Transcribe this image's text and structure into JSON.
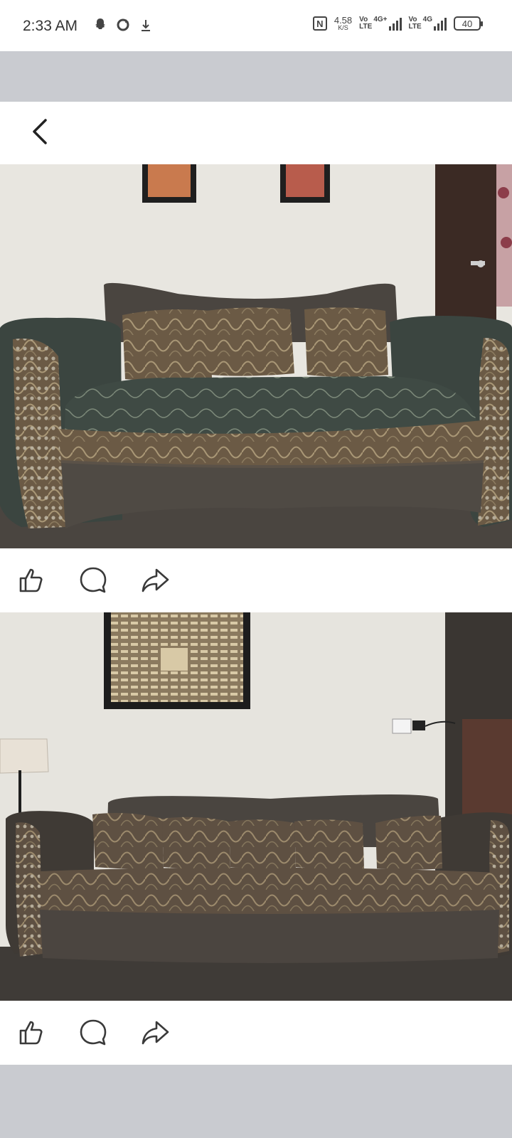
{
  "status_bar": {
    "time": "2:33 AM",
    "net_speed_value": "4.58",
    "net_speed_unit": "K/S",
    "sim1_label_top": "Vo",
    "sim1_label_bottom": "LTE",
    "sim1_network": "4G+",
    "sim2_label_top": "Vo",
    "sim2_label_bottom": "LTE",
    "sim2_network": "4G",
    "battery": "40"
  },
  "posts": [
    {
      "image": "loveseat-sofa-photo",
      "actions": [
        "like-icon",
        "comment-icon",
        "share-icon"
      ]
    },
    {
      "image": "three-seat-sofa-photo",
      "actions": [
        "like-icon",
        "comment-icon",
        "share-icon"
      ]
    }
  ],
  "colors": {
    "bar_background": "#ffffff",
    "page_background": "#c9cbd0",
    "icon_color": "#3a3a3a"
  }
}
